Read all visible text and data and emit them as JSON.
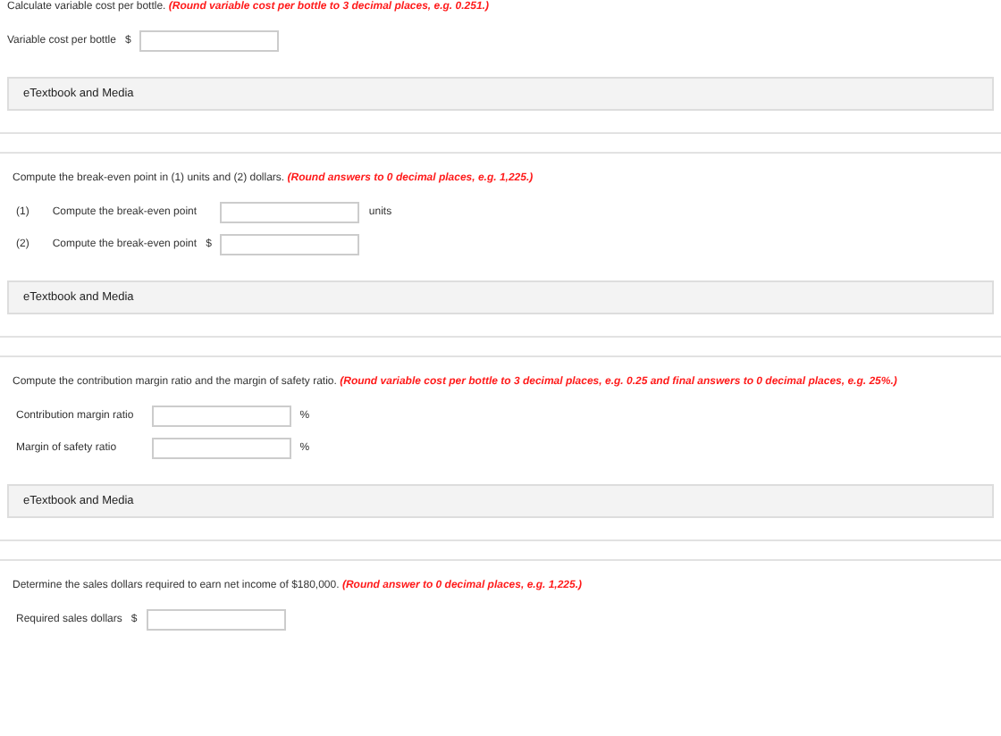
{
  "sections": [
    {
      "instruction": "Calculate variable cost per bottle.",
      "hint": "(Round variable cost per bottle to 3 decimal places, e.g. 0.251.)",
      "rows": [
        {
          "label": "Variable cost per bottle",
          "prefix": "$"
        }
      ],
      "media_label": "eTextbook and Media"
    },
    {
      "instruction": "Compute the break-even point in (1) units and (2) dollars.",
      "hint": "(Round answers to 0 decimal places, e.g. 1,225.)",
      "rows": [
        {
          "number": "(1)",
          "label": "Compute the break-even point",
          "unit": "units"
        },
        {
          "number": "(2)",
          "label": "Compute the break-even point",
          "prefix": "$"
        }
      ],
      "media_label": "eTextbook and Media"
    },
    {
      "instruction": "Compute the contribution margin ratio and the margin of safety ratio.",
      "hint": "(Round variable cost per bottle to 3 decimal places, e.g. 0.25 and final answers to 0 decimal places, e.g. 25%.)",
      "rows": [
        {
          "label": "Contribution margin ratio",
          "unit": "%"
        },
        {
          "label": "Margin of safety ratio",
          "unit": "%"
        }
      ],
      "media_label": "eTextbook and Media"
    },
    {
      "instruction": "Determine the sales dollars required to earn net income of $180,000.",
      "hint": "(Round answer to 0 decimal places, e.g. 1,225.)",
      "rows": [
        {
          "label": "Required sales dollars",
          "prefix": "$"
        }
      ]
    }
  ]
}
